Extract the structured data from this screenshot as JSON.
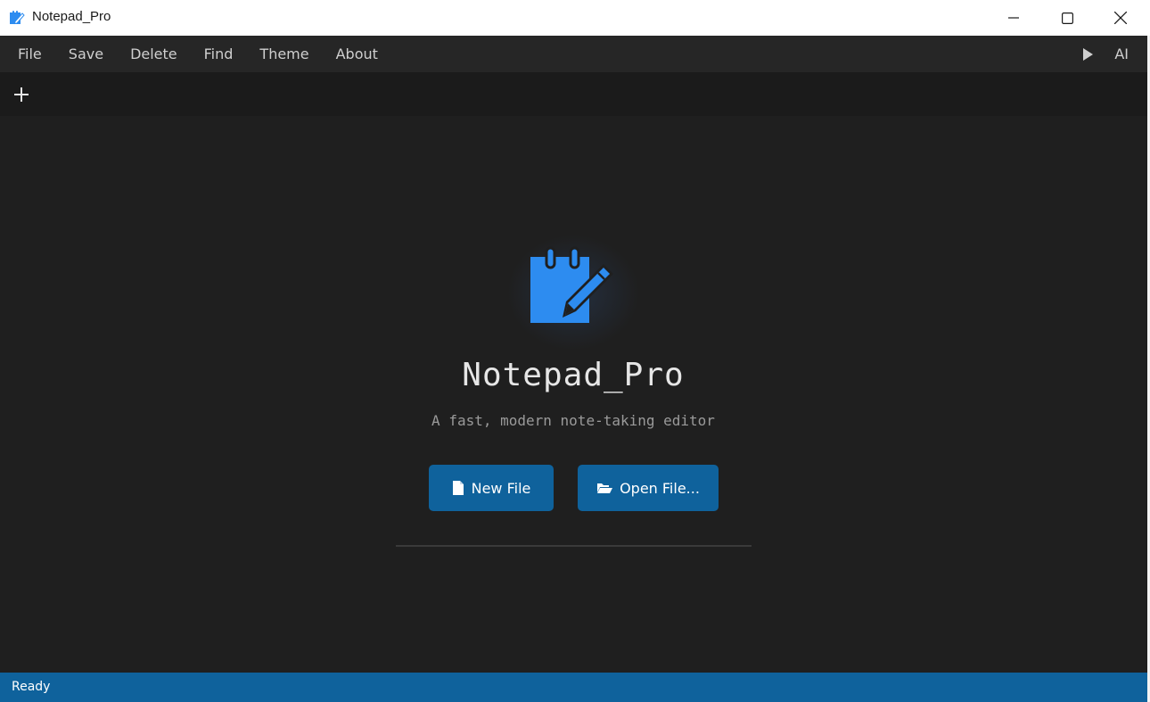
{
  "window": {
    "title": "Notepad_Pro",
    "controls": [
      "minimize",
      "maximize",
      "close"
    ]
  },
  "menubar": {
    "items": [
      {
        "label": "File"
      },
      {
        "label": "Save"
      },
      {
        "label": "Delete"
      },
      {
        "label": "Find"
      },
      {
        "label": "Theme"
      },
      {
        "label": "About"
      }
    ],
    "run_icon": "play-icon",
    "ai_label": "AI"
  },
  "tabbar": {
    "add_icon": "plus-icon"
  },
  "welcome": {
    "logo_icon": "notepad-pencil-icon",
    "title": "Notepad_Pro",
    "subtitle": "A fast, modern note-taking editor",
    "new_file_label": "New File",
    "new_file_icon": "file-icon",
    "open_file_label": "Open File...",
    "open_file_icon": "folder-open-icon"
  },
  "status": {
    "text": "Ready"
  },
  "colors": {
    "accent": "#0f629c",
    "logo_blue": "#2d8cf0",
    "background": "#1f1f1f",
    "menubar": "#262626"
  }
}
